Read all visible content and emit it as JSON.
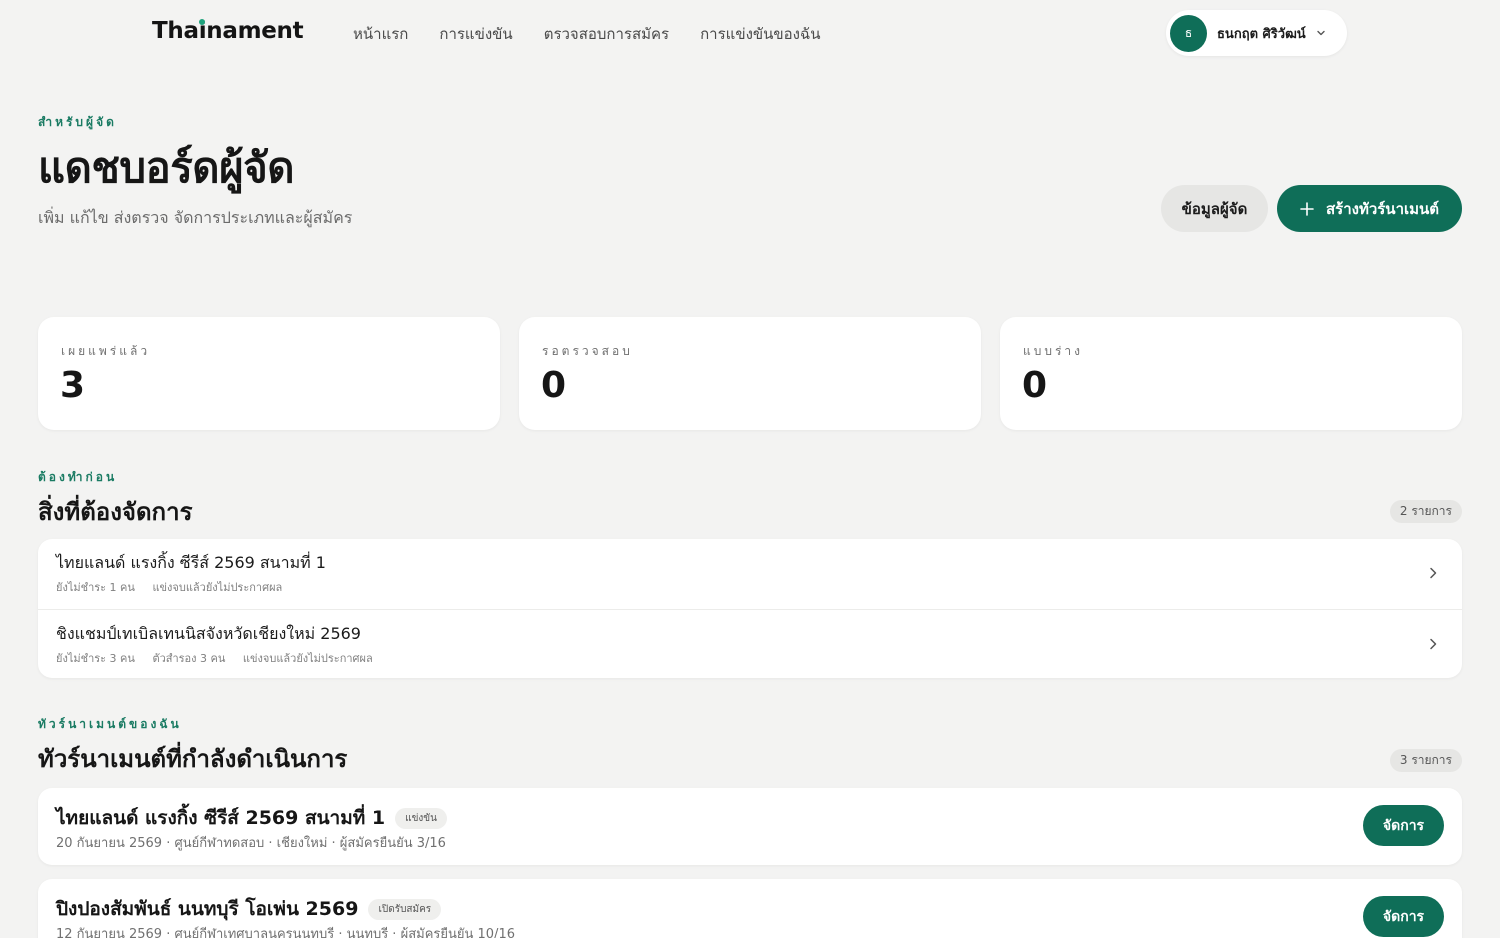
{
  "brand": {
    "logo_prefix": "Tha",
    "logo_i": "i",
    "logo_suffix": "nament"
  },
  "nav": [
    "หน้าแรก",
    "การแข่งขัน",
    "ตรวจสอบการสมัคร",
    "การแข่งขันของฉัน"
  ],
  "user": {
    "initial": "ธ",
    "name": "ธนกฤต ศิริวัฒน์"
  },
  "hero": {
    "eyebrow": "สำหรับผู้จัด",
    "title": "แดชบอร์ดผู้จัด",
    "subtitle": "เพิ่ม แก้ไข ส่งตรวจ จัดการประเภทและผู้สมัคร",
    "secondary_button": "ข้อมูลผู้จัด",
    "primary_button": "สร้างทัวร์นาเมนต์",
    "primary_icon": "plus-icon"
  },
  "stats": [
    {
      "label": "เผยแพร่แล้ว",
      "value": "3"
    },
    {
      "label": "รอตรวจสอบ",
      "value": "0"
    },
    {
      "label": "แบบร่าง",
      "value": "0"
    }
  ],
  "todo": {
    "eyebrow": "ต้องทำก่อน",
    "title": "สิ่งที่ต้องจัดการ",
    "count": "2 รายการ",
    "items": [
      {
        "title": "ไทยแลนด์ แรงกิ้ง ซีรีส์ 2569 สนามที่ 1",
        "meta": [
          "ยังไม่ชำระ 1 คน",
          "แข่งจบแล้วยังไม่ประกาศผล"
        ]
      },
      {
        "title": "ชิงแชมป์เทเบิลเทนนิสจังหวัดเชียงใหม่ 2569",
        "meta": [
          "ยังไม่ชำระ 3 คน",
          "ตัวสำรอง 3 คน",
          "แข่งจบแล้วยังไม่ประกาศผล"
        ]
      }
    ]
  },
  "tournaments": {
    "eyebrow": "ทัวร์นาเมนต์ของฉัน",
    "title": "ทัวร์นาเมนต์ที่กำลังดำเนินการ",
    "count": "3 รายการ",
    "manage_label": "จัดการ",
    "items": [
      {
        "title": "ไทยแลนด์ แรงกิ้ง ซีรีส์ 2569 สนามที่ 1",
        "status": "แข่งขัน",
        "meta": "20 กันยายน 2569 · ศูนย์กีฬาทดสอบ · เชียงใหม่ · ผู้สมัครยืนยัน 3/16"
      },
      {
        "title": "ปิงปองสัมพันธ์ นนทบุรี โอเพ่น 2569",
        "status": "เปิดรับสมัคร",
        "meta": "12 กันยายน 2569 · ศูนย์กีฬาเทศบาลนครนนทบุรี · นนทบุรี · ผู้สมัครยืนยัน 10/16"
      }
    ]
  },
  "colors": {
    "accent": "#0f6e58",
    "accent_text": "#1a7b63",
    "background": "#f3f3f2"
  }
}
